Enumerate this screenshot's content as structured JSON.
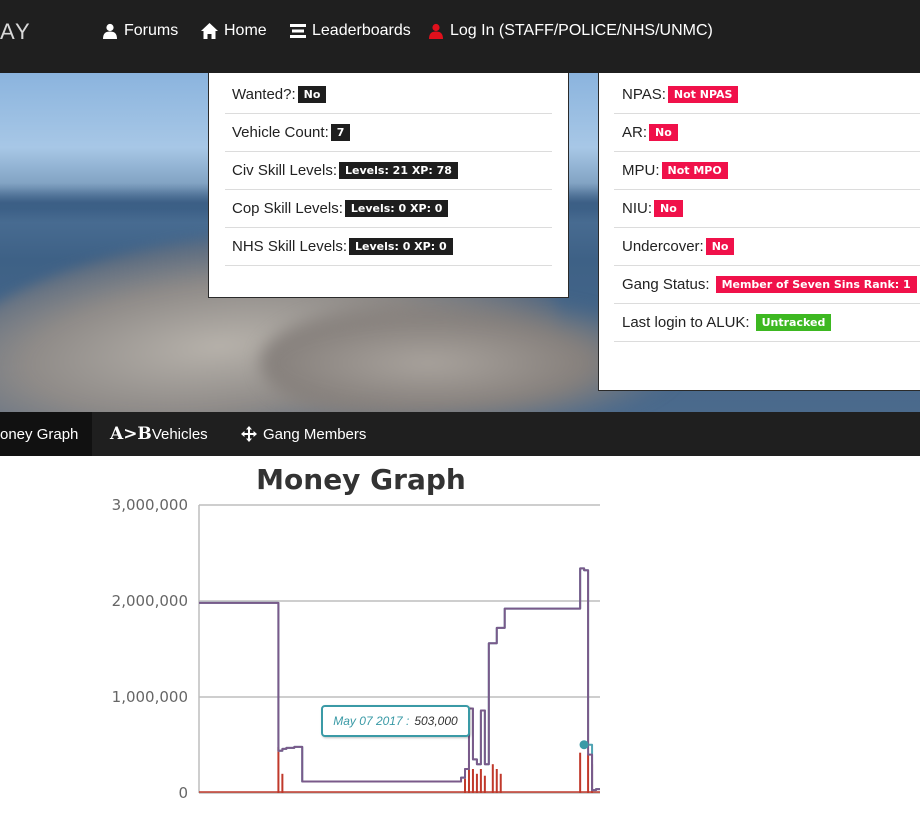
{
  "navbar": {
    "brand": "AY",
    "items": [
      {
        "label": "Forums",
        "icon": "user-icon"
      },
      {
        "label": "Home",
        "icon": "home-icon"
      },
      {
        "label": "Leaderboards",
        "icon": "list-icon"
      },
      {
        "label": "Log In (STAFF/POLICE/NHS/UNMC)",
        "icon": "user-icon",
        "icon_color": "#e0101c"
      }
    ]
  },
  "left_panel": {
    "rows": [
      {
        "label": "Wanted?:",
        "badge": "No",
        "badge_color": "#1e1e1e"
      },
      {
        "label": "Vehicle Count:",
        "badge": "7",
        "badge_color": "#1e1e1e"
      },
      {
        "label": "Civ Skill Levels:",
        "badge": "Levels: 21 XP: 78",
        "badge_color": "#1e1e1e"
      },
      {
        "label": "Cop Skill Levels:",
        "badge": "Levels: 0 XP: 0",
        "badge_color": "#1e1e1e"
      },
      {
        "label": "NHS Skill Levels:",
        "badge": "Levels: 0 XP: 0",
        "badge_color": "#1e1e1e"
      }
    ]
  },
  "right_panel": {
    "rows": [
      {
        "label": "NPAS:",
        "badge": "Not NPAS",
        "badge_color": "#f0114a"
      },
      {
        "label": "AR:",
        "badge": "No",
        "badge_color": "#f0114a"
      },
      {
        "label": "MPU:",
        "badge": "Not MPO",
        "badge_color": "#f0114a"
      },
      {
        "label": "NIU:",
        "badge": "No",
        "badge_color": "#f0114a"
      },
      {
        "label": "Undercover:",
        "badge": "No",
        "badge_color": "#f0114a"
      },
      {
        "label": "Gang Status:",
        "badge": "Member of Seven Sins Rank: 1",
        "badge_color": "#f0114a"
      },
      {
        "label": "Last login to ALUK:",
        "badge": "Untracked",
        "badge_color": "#3db821"
      }
    ]
  },
  "tabs": [
    {
      "label": "oney Graph",
      "icon": "",
      "active": true
    },
    {
      "label": "Vehicles",
      "icon": "A>B"
    },
    {
      "label": "Gang Members",
      "icon": "move-icon"
    }
  ],
  "chart_data": {
    "type": "line",
    "title": "Money Graph",
    "ylim": [
      0,
      3000000
    ],
    "yticks": [
      "3,000,000",
      "2,000,000",
      "1,000,000",
      "0"
    ],
    "grid": true,
    "series": [
      {
        "color": "#7a5a8a",
        "values": [
          1980000,
          1980000,
          1980000,
          1980000,
          1980000,
          1980000,
          1980000,
          1980000,
          1980000,
          1980000,
          1980000,
          1980000,
          1980000,
          1980000,
          1980000,
          1980000,
          1980000,
          1980000,
          1980000,
          1980000,
          440000,
          460000,
          470000,
          470000,
          480000,
          480000,
          120000,
          120000,
          120000,
          120000,
          120000,
          120000,
          120000,
          120000,
          120000,
          120000,
          120000,
          120000,
          120000,
          120000,
          120000,
          120000,
          120000,
          120000,
          120000,
          120000,
          120000,
          120000,
          120000,
          120000,
          120000,
          120000,
          120000,
          120000,
          120000,
          120000,
          120000,
          120000,
          120000,
          120000,
          120000,
          120000,
          120000,
          120000,
          120000,
          120000,
          160000,
          250000,
          880000,
          350000,
          300000,
          860000,
          300000,
          1560000,
          1560000,
          1720000,
          1720000,
          1920000,
          1920000,
          1920000,
          1920000,
          1920000,
          1920000,
          1920000,
          1920000,
          1920000,
          1920000,
          1920000,
          1920000,
          1920000,
          1920000,
          1920000,
          1920000,
          1920000,
          1920000,
          1920000,
          2340000,
          2320000,
          400000,
          30000,
          40000,
          40000
        ]
      },
      {
        "color": "#4fa3b3",
        "values": [
          1980000,
          1980000,
          1980000,
          1980000,
          1980000,
          1980000,
          1980000,
          1980000,
          1980000,
          1980000,
          1980000,
          1980000,
          1980000,
          1980000,
          1980000,
          1980000,
          1980000,
          1980000,
          1980000,
          1980000,
          440000,
          460000,
          470000,
          470000,
          480000,
          480000,
          120000,
          120000,
          120000,
          120000,
          120000,
          120000,
          120000,
          120000,
          120000,
          120000,
          120000,
          120000,
          120000,
          120000,
          120000,
          120000,
          120000,
          120000,
          120000,
          120000,
          120000,
          120000,
          120000,
          120000,
          120000,
          120000,
          120000,
          120000,
          120000,
          120000,
          120000,
          120000,
          120000,
          120000,
          120000,
          120000,
          120000,
          120000,
          120000,
          120000,
          160000,
          250000,
          880000,
          350000,
          300000,
          860000,
          300000,
          1560000,
          1560000,
          1720000,
          1720000,
          1920000,
          1920000,
          1920000,
          1920000,
          1920000,
          1920000,
          1920000,
          1920000,
          1920000,
          1920000,
          1920000,
          1920000,
          1920000,
          1920000,
          1920000,
          1920000,
          1920000,
          1920000,
          1920000,
          2340000,
          2320000,
          503000,
          30000,
          40000,
          40000
        ]
      }
    ],
    "spikes": {
      "color": "#c0392b",
      "values": [
        [
          20,
          480000
        ],
        [
          21,
          200000
        ],
        [
          67,
          150000
        ],
        [
          68,
          300000
        ],
        [
          69,
          250000
        ],
        [
          70,
          200000
        ],
        [
          71,
          250000
        ],
        [
          72,
          180000
        ],
        [
          74,
          300000
        ],
        [
          75,
          250000
        ],
        [
          76,
          200000
        ],
        [
          96,
          420000
        ],
        [
          98,
          400000
        ],
        [
          99,
          300000
        ]
      ]
    },
    "marker": {
      "index": 99,
      "value": 503000,
      "color": "#3a9aa6"
    },
    "tooltip": {
      "date": "May 07 2017 :",
      "value": "503,000"
    }
  }
}
